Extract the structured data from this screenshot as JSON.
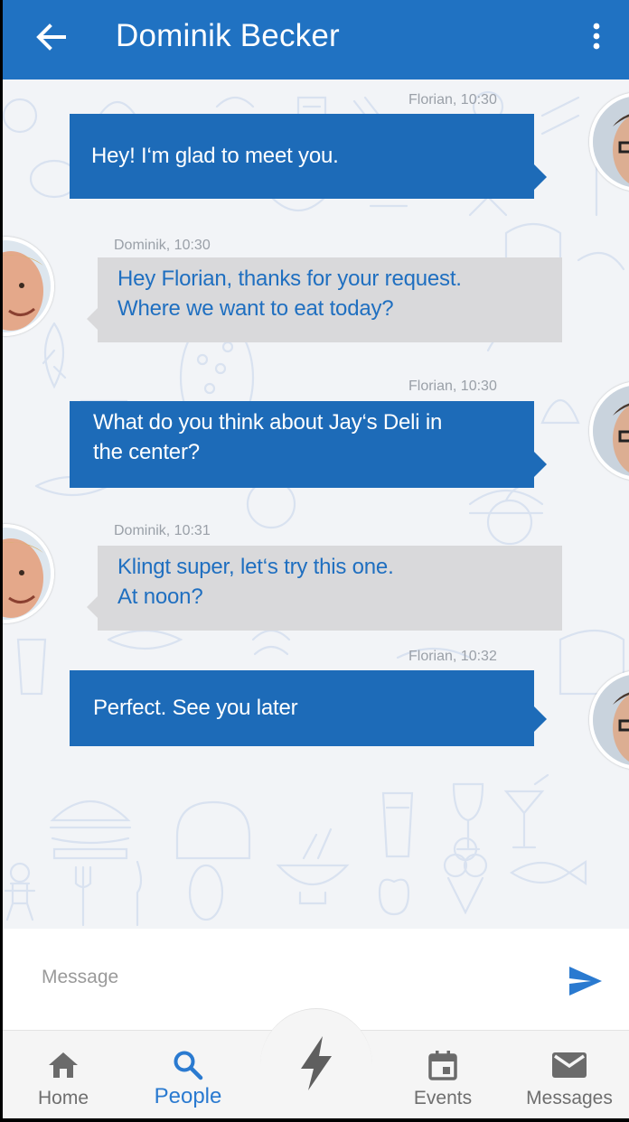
{
  "header": {
    "title": "Dominik Becker",
    "back_icon": "arrow-left-icon",
    "menu_icon": "more-vert-icon",
    "color": "#2072c2"
  },
  "messages": [
    {
      "direction": "out",
      "meta": "Florian, 10:30",
      "lines": [
        "Hey! I‘m glad to meet you."
      ]
    },
    {
      "direction": "in",
      "meta": "Dominik, 10:30",
      "lines": [
        "Hey Florian, thanks for your request.",
        "Where we want to eat today?"
      ]
    },
    {
      "direction": "out",
      "meta": "Florian, 10:30",
      "lines": [
        "What do you think about Jay‘s Deli in",
        "the center?"
      ]
    },
    {
      "direction": "in",
      "meta": "Dominik, 10:31",
      "lines": [
        "Klingt super, let‘s try this one.",
        "At noon?"
      ]
    },
    {
      "direction": "out",
      "meta": "Florian, 10:32",
      "lines": [
        "Perfect. See you later"
      ]
    }
  ],
  "composer": {
    "placeholder": "Message",
    "value": "",
    "send_icon": "send-icon"
  },
  "nav": {
    "items": [
      {
        "label": "Home",
        "icon": "home-icon",
        "active": false
      },
      {
        "label": "People",
        "icon": "search-icon",
        "active": true
      },
      {
        "label": "",
        "icon": "flash-icon",
        "active": false
      },
      {
        "label": "Events",
        "icon": "calendar-icon",
        "active": false
      },
      {
        "label": "Messages",
        "icon": "mail-icon",
        "active": false
      }
    ],
    "active_color": "#2a7ad0"
  },
  "colors": {
    "outgoing_bubble": "#1d6bb8",
    "incoming_bubble": "#d9d9db",
    "incoming_text": "#1f6fc0",
    "chat_background": "#f2f4f7"
  }
}
